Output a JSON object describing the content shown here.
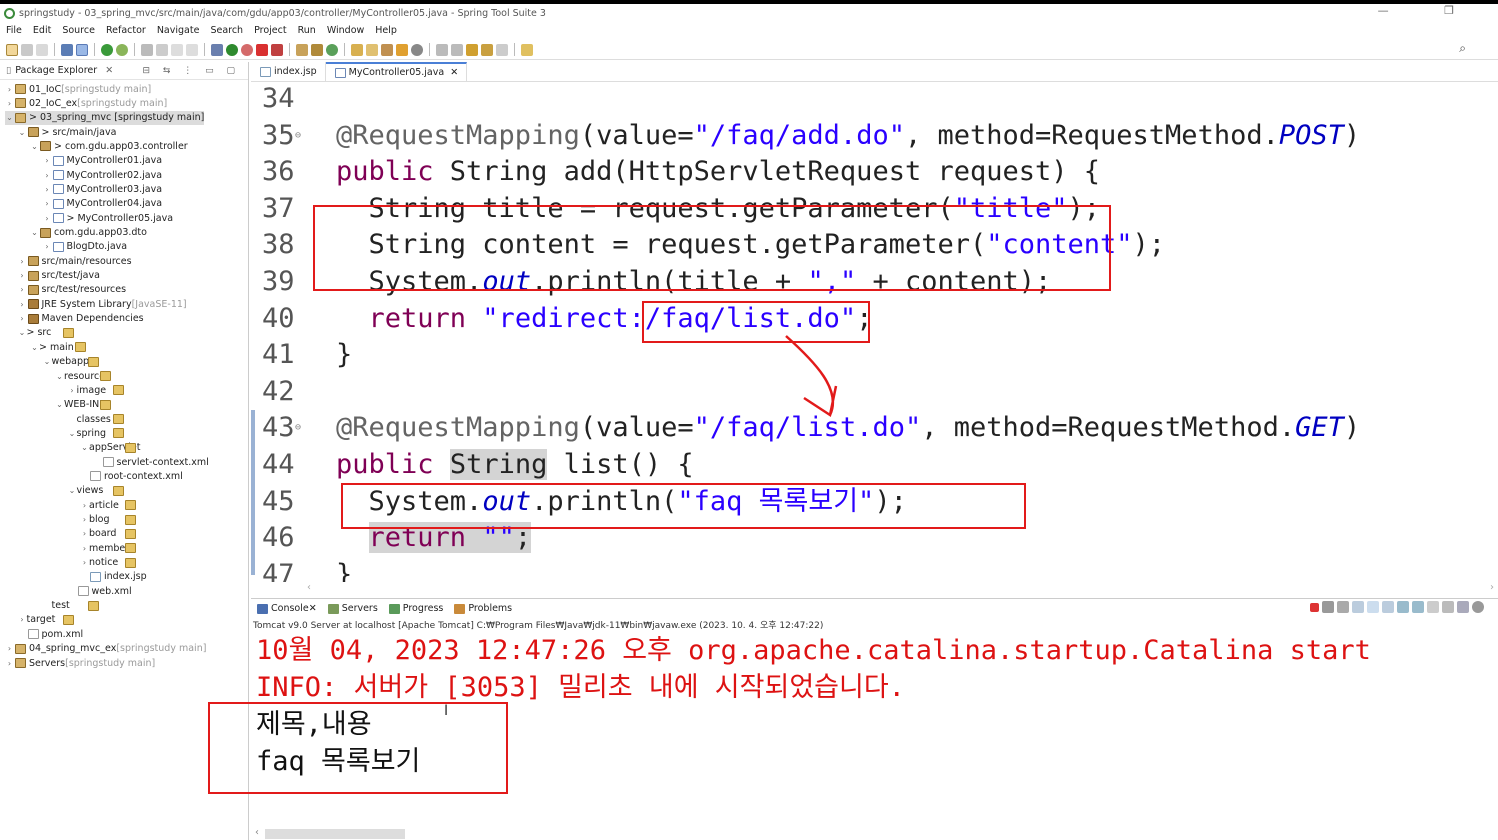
{
  "window": {
    "title": "springstudy - 03_spring_mvc/src/main/java/com/gdu/app03/controller/MyController05.java - Spring Tool Suite 3",
    "controls": "— ❐"
  },
  "menu": [
    "File",
    "Edit",
    "Source",
    "Refactor",
    "Navigate",
    "Search",
    "Project",
    "Run",
    "Window",
    "Help"
  ],
  "explorer": {
    "title": "Package Explorer",
    "items": [
      {
        "t": "01_IoC",
        "s": " [springstudy main]",
        "tw": "›",
        "i": "proj"
      },
      {
        "t": "02_IoC_ex",
        "s": " [springstudy main]",
        "tw": "›",
        "i": "proj"
      },
      {
        "t": "> 03_spring_mvc [springstudy main]",
        "s": "",
        "tw": "⌄",
        "i": "proj"
      },
      {
        "t": "> src/main/java",
        "s": "",
        "tw": "⌄",
        "i": "pkg"
      },
      {
        "t": "> com.gdu.app03.controller",
        "s": "",
        "tw": "⌄",
        "i": "pkg"
      },
      {
        "t": "MyController01.java",
        "s": "",
        "tw": "›",
        "i": "java"
      },
      {
        "t": "MyController02.java",
        "s": "",
        "tw": "›",
        "i": "java"
      },
      {
        "t": "MyController03.java",
        "s": "",
        "tw": "›",
        "i": "java"
      },
      {
        "t": "MyController04.java",
        "s": "",
        "tw": "›",
        "i": "java"
      },
      {
        "t": "> MyController05.java",
        "s": "",
        "tw": "›",
        "i": "java"
      },
      {
        "t": "com.gdu.app03.dto",
        "s": "",
        "tw": "⌄",
        "i": "pkg"
      },
      {
        "t": "BlogDto.java",
        "s": "",
        "tw": "›",
        "i": "java"
      },
      {
        "t": "src/main/resources",
        "s": "",
        "tw": "›",
        "i": "pkg"
      },
      {
        "t": "src/test/java",
        "s": "",
        "tw": "›",
        "i": "pkg"
      },
      {
        "t": "src/test/resources",
        "s": "",
        "tw": "›",
        "i": "pkg"
      },
      {
        "t": "JRE System Library",
        "s": " [JavaSE-11]",
        "tw": "›",
        "i": "lib"
      },
      {
        "t": "Maven Dependencies",
        "s": "",
        "tw": "›",
        "i": "lib"
      },
      {
        "t": "> src",
        "s": "",
        "tw": "⌄",
        "i": "fold"
      },
      {
        "t": "> main",
        "s": "",
        "tw": "⌄",
        "i": "fold"
      },
      {
        "t": "webapp",
        "s": "",
        "tw": "⌄",
        "i": "fold"
      },
      {
        "t": "resources",
        "s": "",
        "tw": "⌄",
        "i": "fold"
      },
      {
        "t": "image",
        "s": "",
        "tw": "›",
        "i": "fold"
      },
      {
        "t": "WEB-INF",
        "s": "",
        "tw": "⌄",
        "i": "fold"
      },
      {
        "t": "classes",
        "s": "",
        "tw": "",
        "i": "fold"
      },
      {
        "t": "spring",
        "s": "",
        "tw": "⌄",
        "i": "fold"
      },
      {
        "t": "appServlet",
        "s": "",
        "tw": "⌄",
        "i": "fold"
      },
      {
        "t": "servlet-context.xml",
        "s": "",
        "tw": "",
        "i": "xml"
      },
      {
        "t": "root-context.xml",
        "s": "",
        "tw": "",
        "i": "xml"
      },
      {
        "t": "views",
        "s": "",
        "tw": "⌄",
        "i": "fold"
      },
      {
        "t": "article",
        "s": "",
        "tw": "›",
        "i": "fold"
      },
      {
        "t": "blog",
        "s": "",
        "tw": "›",
        "i": "fold"
      },
      {
        "t": "board",
        "s": "",
        "tw": "›",
        "i": "fold"
      },
      {
        "t": "member",
        "s": "",
        "tw": "›",
        "i": "fold"
      },
      {
        "t": "notice",
        "s": "",
        "tw": "›",
        "i": "fold"
      },
      {
        "t": "index.jsp",
        "s": "",
        "tw": "",
        "i": "jsp"
      },
      {
        "t": "web.xml",
        "s": "",
        "tw": "",
        "i": "xml"
      },
      {
        "t": "test",
        "s": "",
        "tw": "",
        "i": "fold"
      },
      {
        "t": "target",
        "s": "",
        "tw": "›",
        "i": "fold"
      },
      {
        "t": "pom.xml",
        "s": "",
        "tw": "",
        "i": "xml"
      },
      {
        "t": "04_spring_mvc_ex",
        "s": " [springstudy main]",
        "tw": "›",
        "i": "proj"
      },
      {
        "t": "Servers",
        "s": " [springstudy main]",
        "tw": "›",
        "i": "proj"
      }
    ]
  },
  "editor": {
    "tabs": [
      "index.jsp",
      "MyController05.java"
    ],
    "lines": [
      {
        "n": "34",
        "c": []
      },
      {
        "n": "35",
        "c": [
          [
            "an",
            "@RequestMapping"
          ],
          [
            "",
            "(value="
          ],
          [
            "st",
            "\"/faq/add.do\""
          ],
          [
            "",
            ", method=RequestMethod."
          ],
          [
            "fi",
            "POST"
          ],
          [
            "",
            ")"
          ]
        ]
      },
      {
        "n": "36",
        "c": [
          [
            "kw",
            "public"
          ],
          [
            "",
            " String add(HttpServletRequest request) {"
          ]
        ]
      },
      {
        "n": "37",
        "c": [
          [
            "",
            "  String title = request.getParameter("
          ],
          [
            "st",
            "\"title\""
          ],
          [
            "",
            ");"
          ]
        ]
      },
      {
        "n": "38",
        "c": [
          [
            "",
            "  String content = request.getParameter("
          ],
          [
            "st",
            "\"content\""
          ],
          [
            "",
            ");"
          ]
        ]
      },
      {
        "n": "39",
        "c": [
          [
            "",
            "  System."
          ],
          [
            "fi",
            "out"
          ],
          [
            "",
            ".println(title + "
          ],
          [
            "st",
            "\",\""
          ],
          [
            "",
            " + content);"
          ]
        ]
      },
      {
        "n": "40",
        "c": [
          [
            "kw",
            "  return"
          ],
          [
            "",
            ""
          ],
          [
            "st",
            " \"redirect:/faq/list.do\""
          ],
          [
            "",
            ";"
          ]
        ]
      },
      {
        "n": "41",
        "c": [
          [
            "",
            "}"
          ]
        ]
      },
      {
        "n": "42",
        "c": []
      },
      {
        "n": "43",
        "c": [
          [
            "an",
            "@RequestMapping"
          ],
          [
            "",
            "(value="
          ],
          [
            "st",
            "\"/faq/list.do\""
          ],
          [
            "",
            ", method=RequestMethod."
          ],
          [
            "fi",
            "GET"
          ],
          [
            "",
            ")"
          ]
        ]
      },
      {
        "n": "44",
        "c": [
          [
            "kw",
            "public"
          ],
          [
            "",
            " "
          ],
          [
            "hl",
            "String"
          ],
          [
            "",
            " list() {"
          ]
        ]
      },
      {
        "n": "45",
        "c": [
          [
            "",
            "  System."
          ],
          [
            "fi",
            "out"
          ],
          [
            "",
            ".println("
          ],
          [
            "st",
            "\"faq 목록보기\""
          ],
          [
            "",
            ");"
          ]
        ]
      },
      {
        "n": "46",
        "c": [
          [
            "",
            "  "
          ],
          [
            "kw hl",
            "return"
          ],
          [
            "hl",
            " "
          ],
          [
            "st hl",
            "\"\""
          ],
          [
            "hl",
            ";"
          ]
        ]
      },
      {
        "n": "47",
        "c": [
          [
            "",
            "}"
          ]
        ]
      }
    ]
  },
  "console": {
    "tabs": [
      "Console",
      "Servers",
      "Progress",
      "Problems"
    ],
    "status": "Tomcat v9.0 Server at localhost [Apache Tomcat] C:₩Program Files₩Java₩jdk-11₩bin₩javaw.exe  (2023. 10. 4. 오후 12:47:22)",
    "lines": [
      {
        "text": "10월 04, 2023 12:47:26 오후 org.apache.catalina.startup.Catalina start",
        "cls": "red"
      },
      {
        "text": "INFO: 서버가 [3053] 밀리초 내에 시작되었습니다.",
        "cls": "red"
      },
      {
        "text": "제목,내용",
        "cls": "blk"
      },
      {
        "text": "faq 목록보기",
        "cls": "blk"
      }
    ]
  },
  "colors": {
    "annotation": "#e21a1a",
    "keyword": "#7f0055",
    "string": "#2a00ff",
    "static_field": "#0000c0",
    "console_err": "#dd1212"
  }
}
